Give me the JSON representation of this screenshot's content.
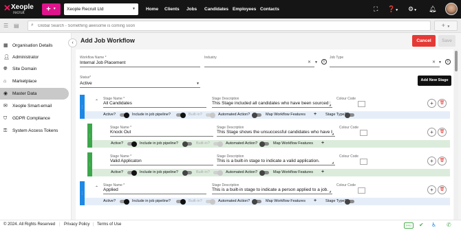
{
  "topbar": {
    "logo_text": "Xeople",
    "logo_sub": "recruit",
    "add_label": "+",
    "company": "Xeople Recruit Ltd",
    "nav": [
      "Home",
      "Clients",
      "Jobs",
      "Candidates",
      "Employees",
      "Contacts"
    ]
  },
  "search": {
    "placeholder": "Global Search - Something awesome is coming soon",
    "add_label": "+"
  },
  "sidebar": {
    "items": [
      {
        "label": "Organisation Details",
        "icon": "building-icon"
      },
      {
        "label": "Administrator",
        "icon": "person-icon"
      },
      {
        "label": "Site Domain",
        "icon": "globe-icon"
      },
      {
        "label": "Marketplace",
        "icon": "store-icon"
      },
      {
        "label": "Master Data",
        "icon": "database-icon"
      },
      {
        "label": "Xeople Smart-email",
        "icon": "envelope-icon"
      },
      {
        "label": "GDPR Compliance",
        "icon": "shield-icon"
      },
      {
        "label": "System Access Tokens",
        "icon": "key-icon"
      }
    ],
    "active_index": 4
  },
  "page": {
    "title": "Add Job Workflow",
    "cancel_label": "Cancel",
    "save_label": "Save"
  },
  "form": {
    "workflow_name_label": "Workflow Name *",
    "workflow_name_value": "Internal Job Placement",
    "industry_label": "Industry",
    "industry_value": "",
    "job_type_label": "Job Type",
    "job_type_value": "",
    "status_label": "Status*",
    "status_value": "Active",
    "add_stage_label": "Add New Stage"
  },
  "stage_labels": {
    "name": "Stage Name *",
    "description": "Stage Description",
    "colour": "Colour Code",
    "active": "Active?",
    "pipeline": "Include in job pipeline?",
    "builtin": "Built-in?",
    "automated": "Automated Action?",
    "map": "Map Workflow Features",
    "stage_type": "Stage Type?"
  },
  "stages": [
    {
      "name": "All Candidates",
      "description": "This Stage included all candidates who have been sourced from Job boards & internal sources"
    },
    {
      "name": "Knock Out",
      "description": "This Stage shows the unsuccessful candidates who have been declined or Knocked Out at this Stage"
    },
    {
      "name": "Valid Applicaton",
      "description": "This is a built-in stage to indicate a valid application."
    },
    {
      "name": "Applied",
      "description": "This is a built-in stage to indicate a person applied to a job."
    }
  ],
  "footer": {
    "copyright": "© 2024. All Rights Reserved",
    "privacy": "Privacy Policy",
    "terms": "Terms of Use",
    "badge": "PPD"
  },
  "colors": {
    "brand_pink": "#e0138c",
    "cancel_red": "#e53935",
    "stage_green": "#3ca64a",
    "stage_blue": "#1e88e5"
  }
}
